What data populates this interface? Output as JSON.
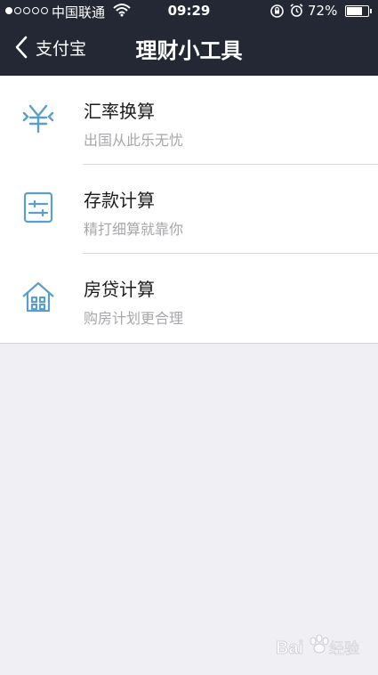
{
  "status_bar": {
    "carrier": "中国联通",
    "time": "09:29",
    "battery_percent": "72%",
    "battery_level": 0.72,
    "signal_filled": 1,
    "signal_total": 5
  },
  "nav": {
    "back_label": "支付宝",
    "title": "理财小工具"
  },
  "list": {
    "items": [
      {
        "title": "汇率换算",
        "subtitle": "出国从此乐无忧",
        "icon": "yen-exchange-icon"
      },
      {
        "title": "存款计算",
        "subtitle": "精打细算就靠你",
        "icon": "sliders-icon"
      },
      {
        "title": "房贷计算",
        "subtitle": "购房计划更合理",
        "icon": "house-icon"
      }
    ]
  },
  "colors": {
    "nav_background": "#232834",
    "icon_blue": "#5a9fc8",
    "page_background": "#efeff4"
  },
  "watermark": {
    "text": "Bai 经验"
  }
}
